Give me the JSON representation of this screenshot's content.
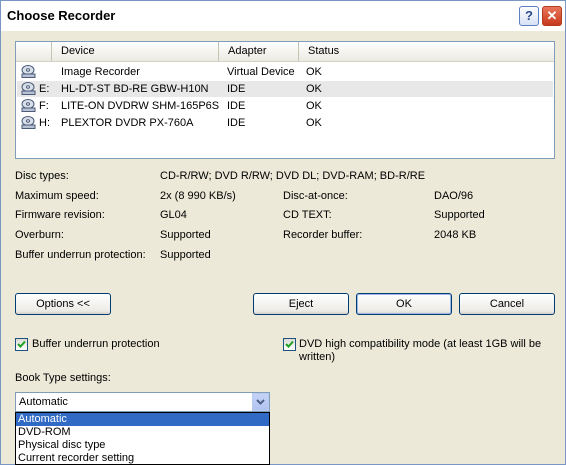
{
  "window": {
    "title": "Choose Recorder",
    "help_glyph": "?",
    "close_glyph": "✕"
  },
  "device_list": {
    "columns": [
      "Device",
      "Adapter",
      "Status"
    ],
    "rows": [
      {
        "icon": "image-recorder-icon",
        "drive": "",
        "device": "Image Recorder",
        "adapter": "Virtual Device",
        "status": "OK",
        "selected": false
      },
      {
        "icon": "optical-drive-icon",
        "drive": "E:",
        "device": "HL-DT-ST BD-RE  GBW-H10N",
        "adapter": "IDE",
        "status": "OK",
        "selected": true
      },
      {
        "icon": "optical-drive-icon",
        "drive": "F:",
        "device": "LITE-ON DVDRW SHM-165P6S",
        "adapter": "IDE",
        "status": "OK",
        "selected": false
      },
      {
        "icon": "optical-drive-icon",
        "drive": "H:",
        "device": "PLEXTOR DVDR   PX-760A",
        "adapter": "IDE",
        "status": "OK",
        "selected": false
      }
    ]
  },
  "info": {
    "disc_types_label": "Disc types:",
    "disc_types_value": "CD-R/RW; DVD R/RW; DVD DL; DVD-RAM; BD-R/RE",
    "max_speed_label": "Maximum speed:",
    "max_speed_value": "2x (8 990 KB/s)",
    "disc_at_once_label": "Disc-at-once:",
    "disc_at_once_value": "DAO/96",
    "firmware_label": "Firmware revision:",
    "firmware_value": "GL04",
    "cd_text_label": "CD TEXT:",
    "cd_text_value": "Supported",
    "overburn_label": "Overburn:",
    "overburn_value": "Supported",
    "recorder_buffer_label": "Recorder buffer:",
    "recorder_buffer_value": "2048 KB",
    "buffer_underrun_label": "Buffer underrun protection:",
    "buffer_underrun_value": "Supported"
  },
  "buttons": {
    "options": "Options <<",
    "eject": "Eject",
    "ok": "OK",
    "cancel": "Cancel"
  },
  "options": {
    "buffer_underrun_checkbox": "Buffer underrun protection",
    "buffer_underrun_checked": true,
    "dvd_compat_checkbox_line1": "DVD high compatibility mode (at least 1GB will be",
    "dvd_compat_checkbox_line2": "written)",
    "dvd_compat_checked": true,
    "book_type_label": "Book Type settings:",
    "book_type_selected": "Automatic",
    "book_type_options": [
      "Automatic",
      "DVD-ROM",
      "Physical disc type",
      "Current recorder setting"
    ]
  },
  "colors": {
    "highlight": "#316ac5",
    "selected_row": "#e8e8e8",
    "dialog_bg": "#ece9d8"
  }
}
